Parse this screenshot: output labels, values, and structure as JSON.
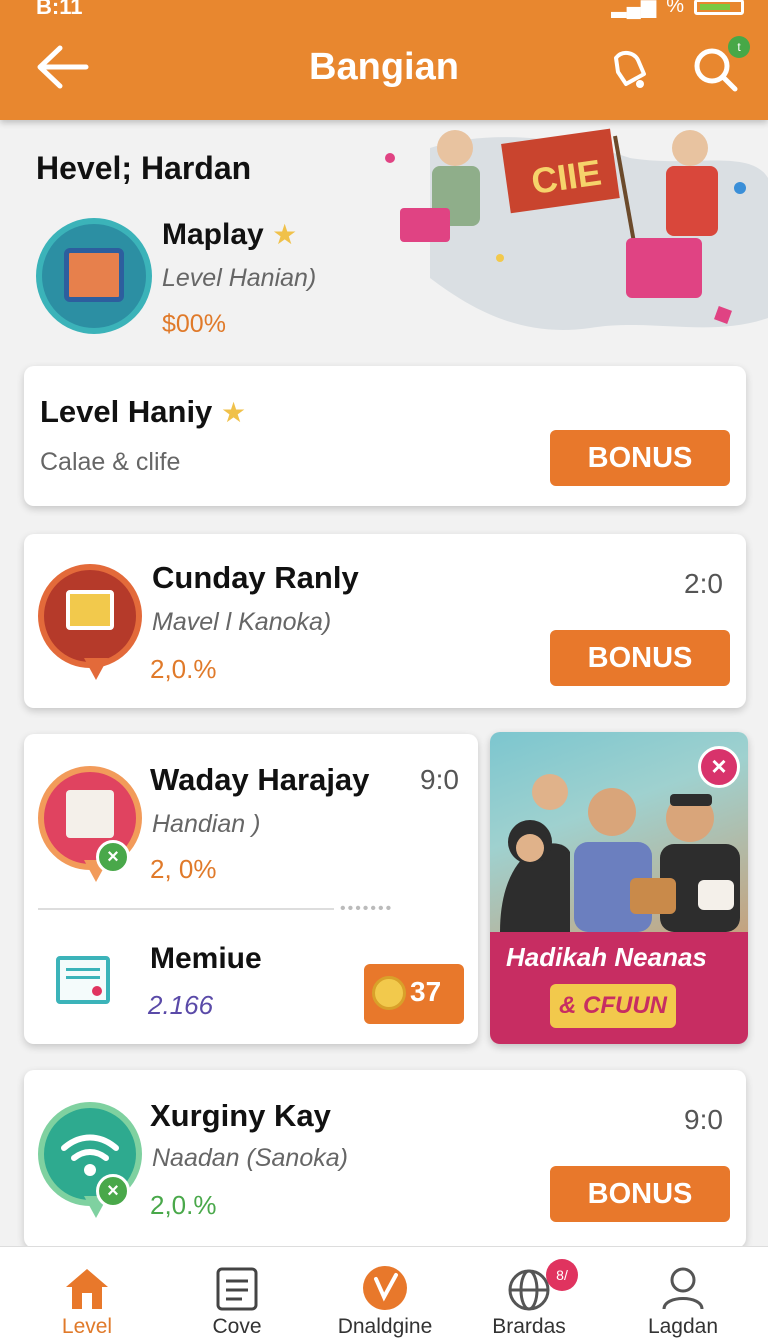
{
  "status": {
    "time": "B:11",
    "battery_text": "%"
  },
  "header": {
    "title": "Bangian"
  },
  "hero": {
    "heading": "Hevel; Hardan",
    "name": "Maplay",
    "subtitle": "Level Hanian)",
    "value": "$00%",
    "banner_text": "CIIE"
  },
  "cards": [
    {
      "title": "Level Haniy",
      "subtitle": "Calae & clife",
      "button": "BONUS"
    },
    {
      "title": "Cunday Ranly",
      "subtitle": "Mavel l Kanoka)",
      "value": "2,0.%",
      "time": "2:0",
      "button": "BONUS"
    },
    {
      "title": "Waday Harajay",
      "subtitle": "Handian )",
      "value": "2, 0%",
      "time": "9:0",
      "sub_item": {
        "title": "Memiue",
        "value": "2.166",
        "coin": "37"
      }
    },
    {
      "title": "Xurginy Kay",
      "subtitle": "Naadan (Sanoka)",
      "value": "2,0.%",
      "time": "9:0",
      "button": "BONUS"
    }
  ],
  "promo": {
    "title": "Hadikah Neanas",
    "tag": "& CFUUN"
  },
  "nav": {
    "items": [
      {
        "label": "Level"
      },
      {
        "label": "Cove"
      },
      {
        "label": "Dnaldgine"
      },
      {
        "label": "Brardas",
        "badge": "8/"
      },
      {
        "label": "Lagdan"
      }
    ]
  },
  "colors": {
    "accent": "#e8872f",
    "button": "#e8782b",
    "promo": "#c72d62",
    "success": "#49a84a"
  }
}
